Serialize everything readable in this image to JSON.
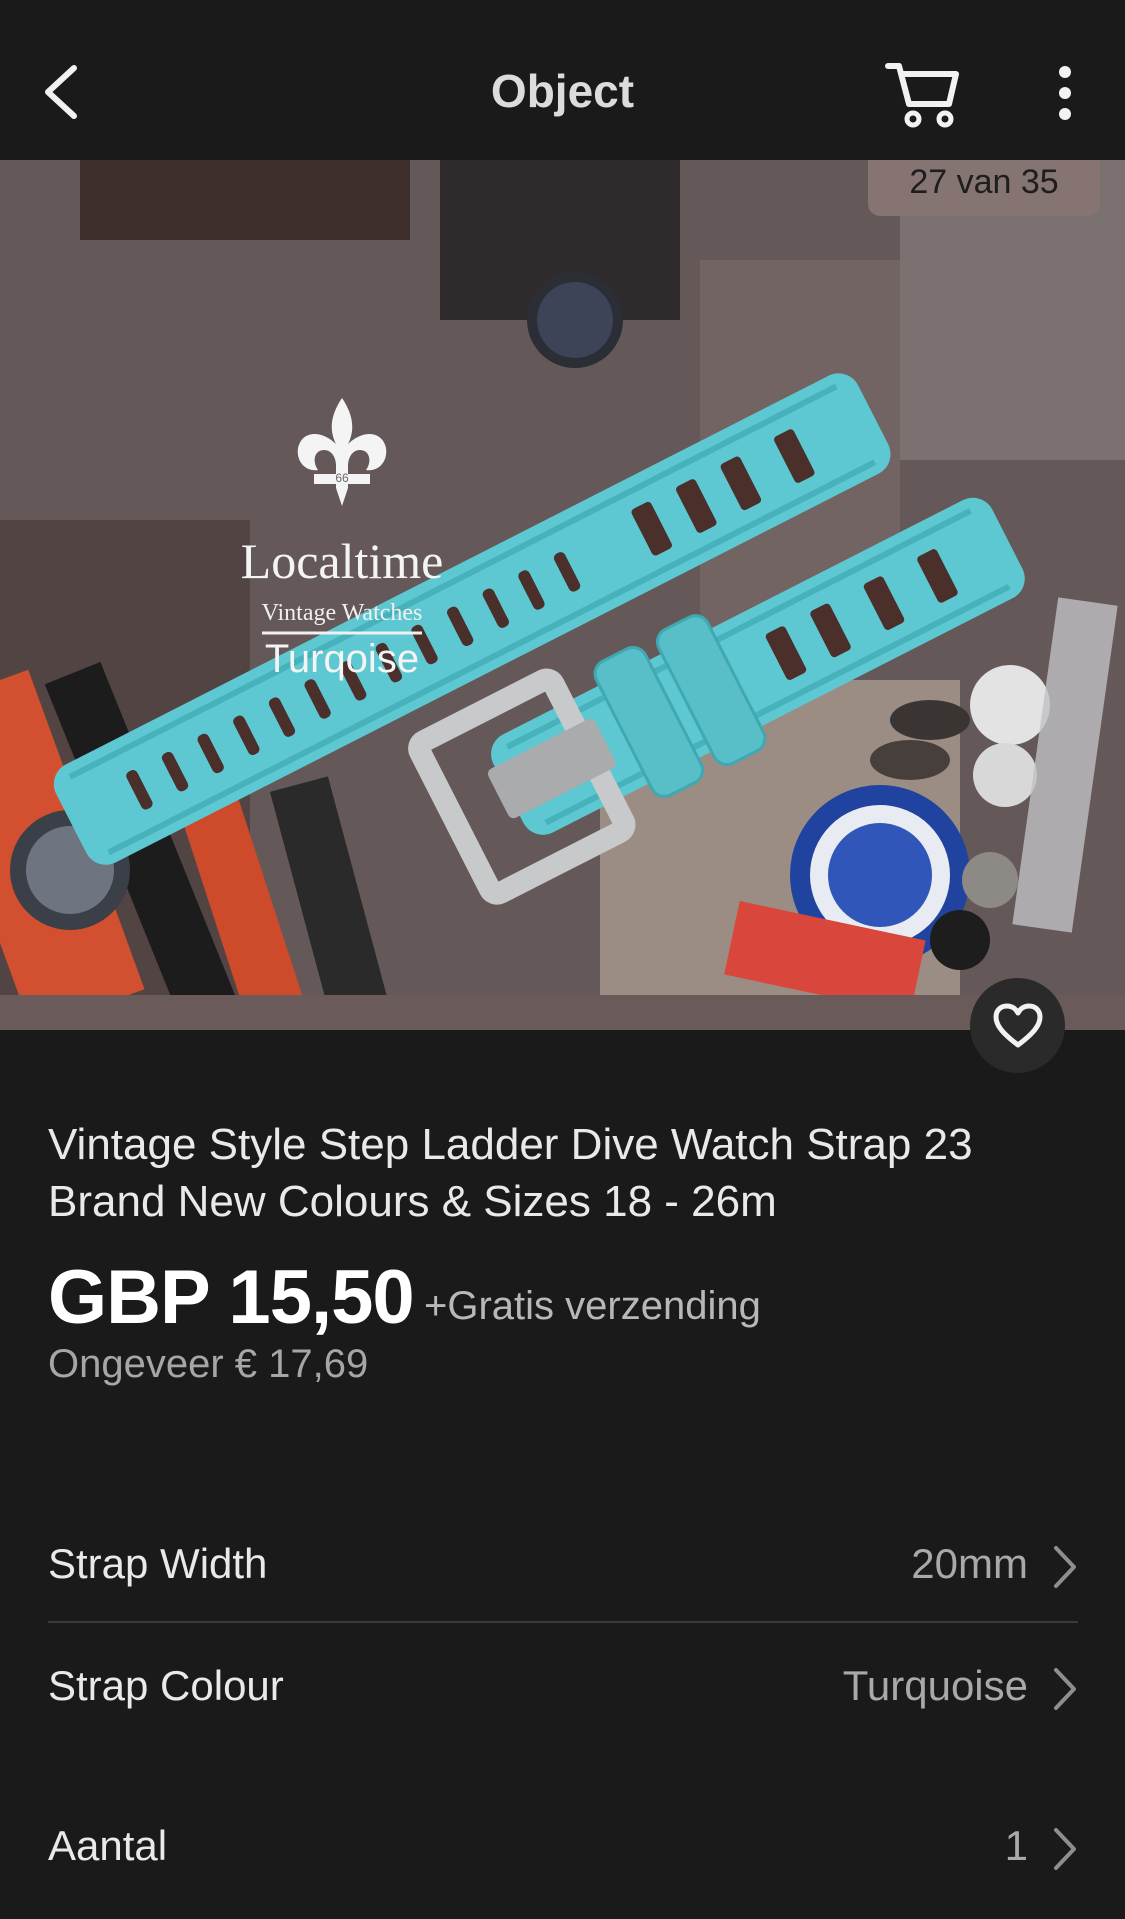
{
  "header": {
    "title": "Object"
  },
  "gallery": {
    "counter": "27 van 35",
    "logo_name": "Localtime",
    "logo_tagline": "Vintage Watches",
    "logo_color": "Turqoise",
    "logo_badge": "66"
  },
  "product": {
    "title": "Vintage Style Step Ladder Dive Watch Strap 23 Brand New Colours & Sizes 18 - 26m",
    "price": "GBP 15,50",
    "shipping": "+Gratis verzending",
    "approx_price": "Ongeveer € 17,69"
  },
  "options": [
    {
      "label": "Strap Width",
      "value": "20mm"
    },
    {
      "label": "Strap Colour",
      "value": "Turquoise"
    },
    {
      "label": "Aantal",
      "value": "1"
    }
  ],
  "colors": {
    "background": "#1a1a1b",
    "strap": "#5ec8d2",
    "counter_bg": "#857471"
  },
  "icons": [
    "back-chevron-icon",
    "cart-icon",
    "more-vertical-icon",
    "heart-icon",
    "chevron-right-icon"
  ]
}
